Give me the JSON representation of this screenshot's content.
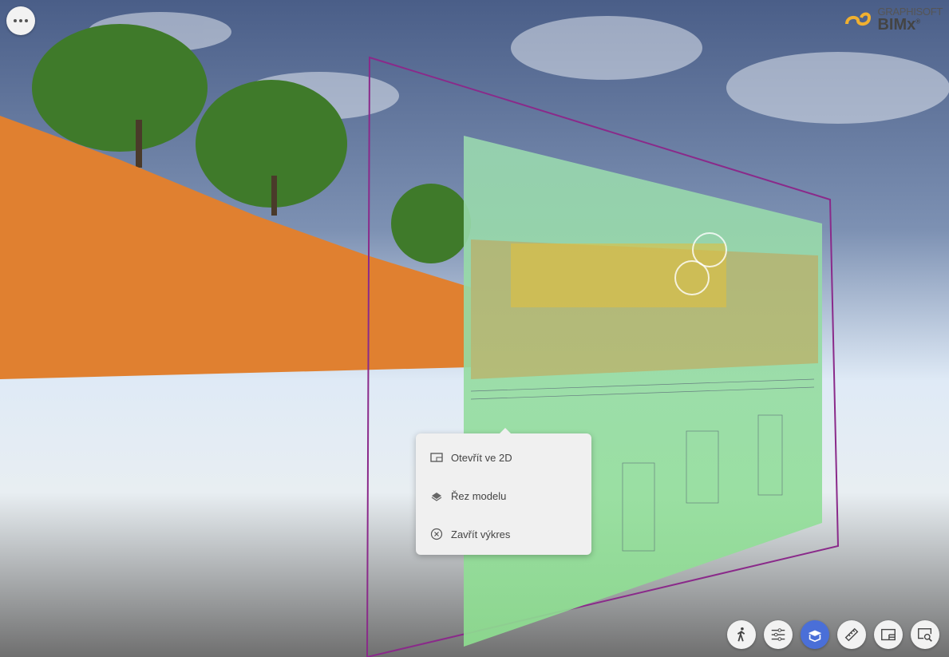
{
  "logo": {
    "brand": "GRAPHISOFT",
    "product": "BIMx",
    "mark": "®"
  },
  "context_menu": {
    "items": [
      {
        "label": "Otevřít ve 2D",
        "icon": "open-2d-icon"
      },
      {
        "label": "Řez modelu",
        "icon": "section-model-icon"
      },
      {
        "label": "Zavřít výkres",
        "icon": "close-circle-icon"
      }
    ]
  },
  "toolbar": {
    "items": [
      {
        "name": "walk",
        "icon": "walk-icon"
      },
      {
        "name": "settings",
        "icon": "sliders-icon"
      },
      {
        "name": "section-box",
        "icon": "section-box-icon",
        "active": true
      },
      {
        "name": "measure",
        "icon": "ruler-icon"
      },
      {
        "name": "drawings",
        "icon": "drawing-icon"
      },
      {
        "name": "search",
        "icon": "search-screen-icon"
      }
    ]
  },
  "colors": {
    "accent": "#4a6fd8",
    "terrain": "#e08030",
    "sheet": "#8fe0a0",
    "frame": "#8a2a8a"
  }
}
